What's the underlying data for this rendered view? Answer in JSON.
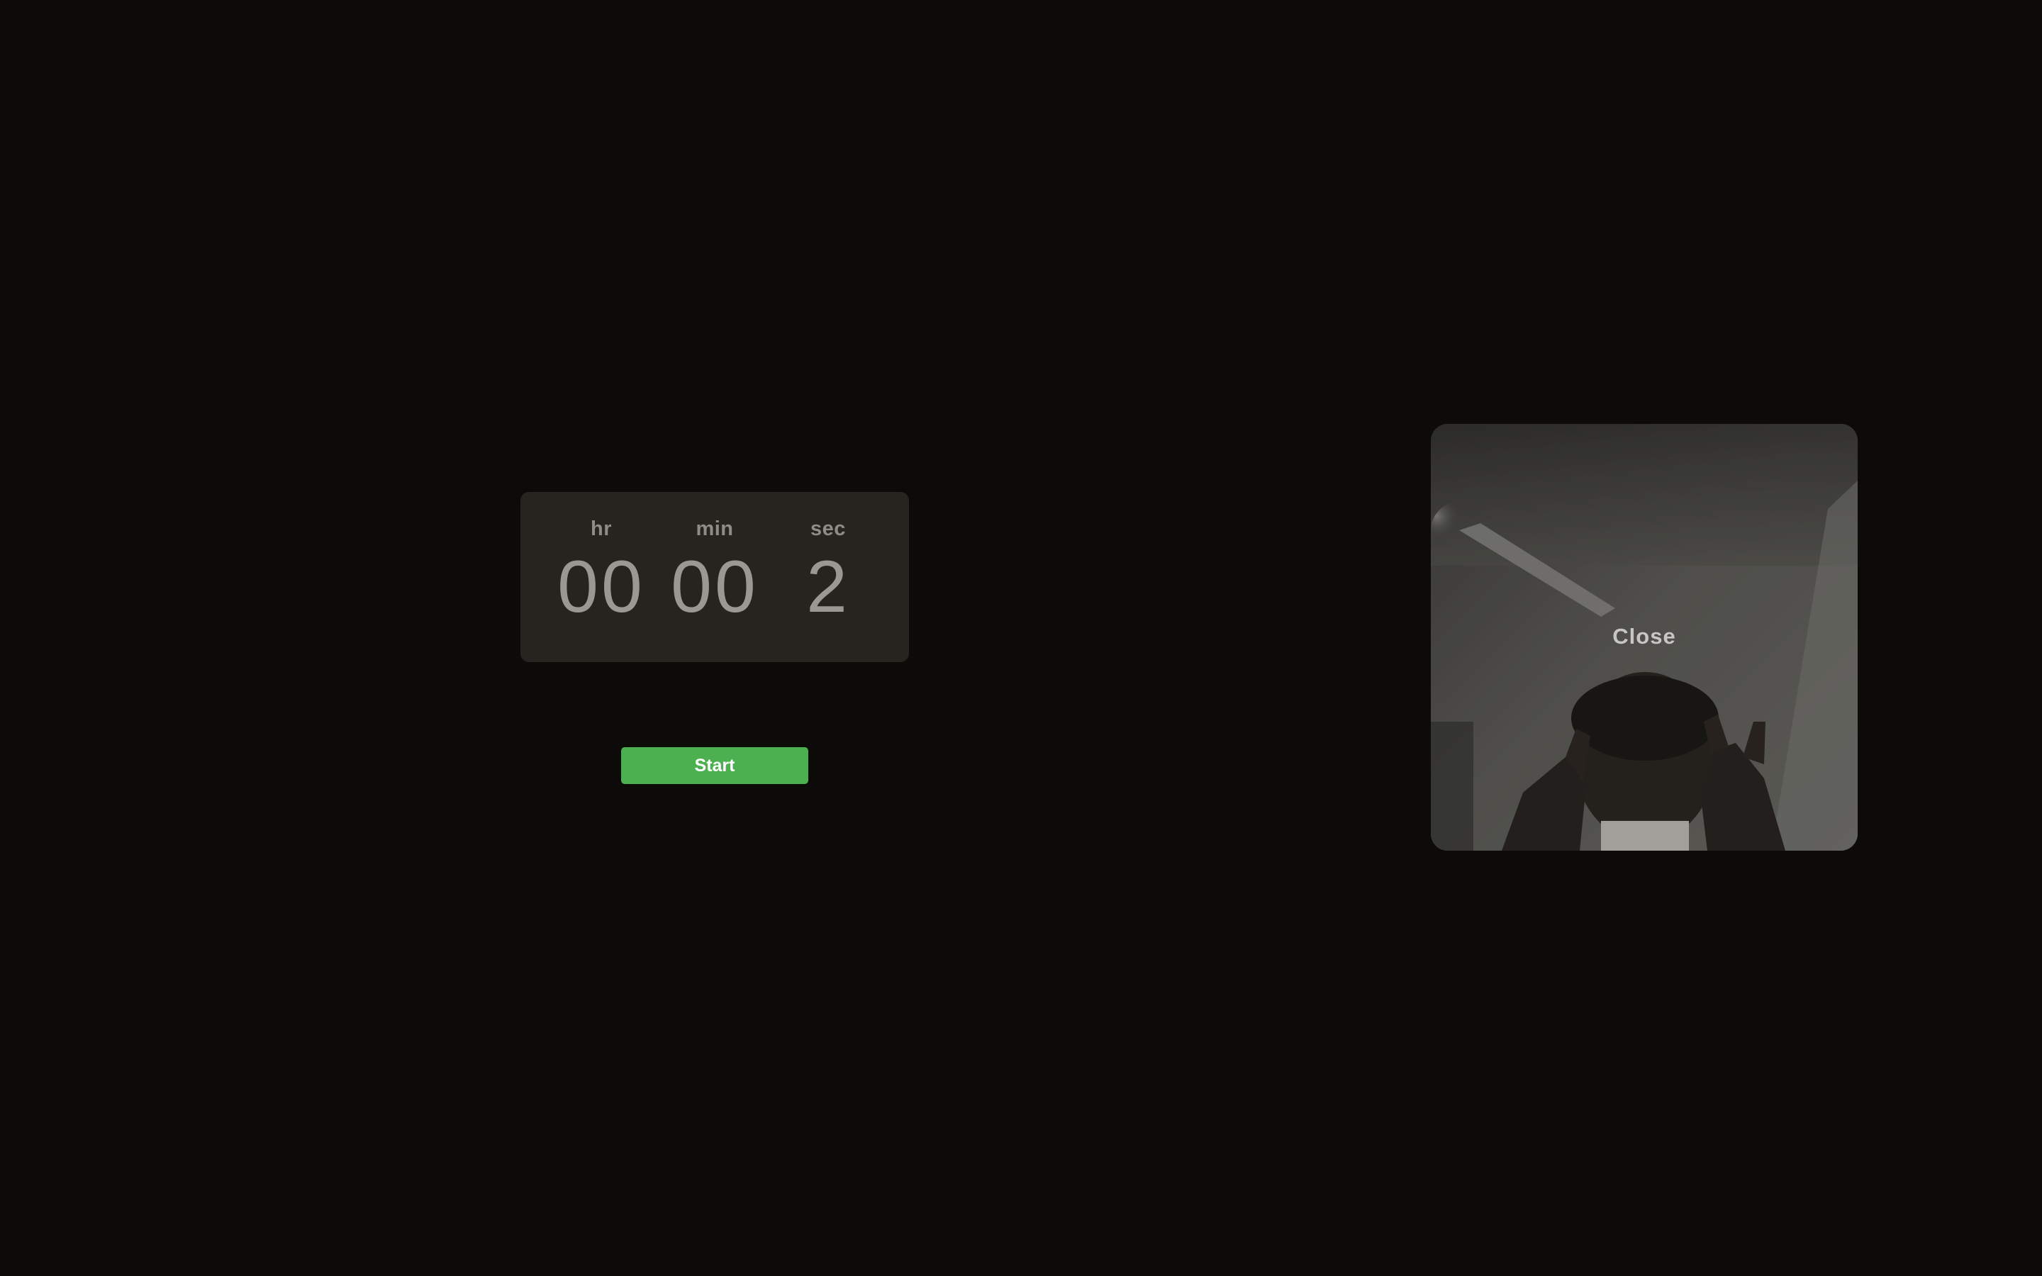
{
  "timer": {
    "hours_label": "hr",
    "minutes_label": "min",
    "seconds_label": "sec",
    "hours_value": "00",
    "minutes_value": "00",
    "seconds_value": "2"
  },
  "controls": {
    "start_label": "Start"
  },
  "camera": {
    "close_label": "Close"
  },
  "colors": {
    "background": "#0c0b0a",
    "timer_card": "#27231f",
    "start_button": "#4caf50",
    "label_text": "#8f8b87"
  }
}
